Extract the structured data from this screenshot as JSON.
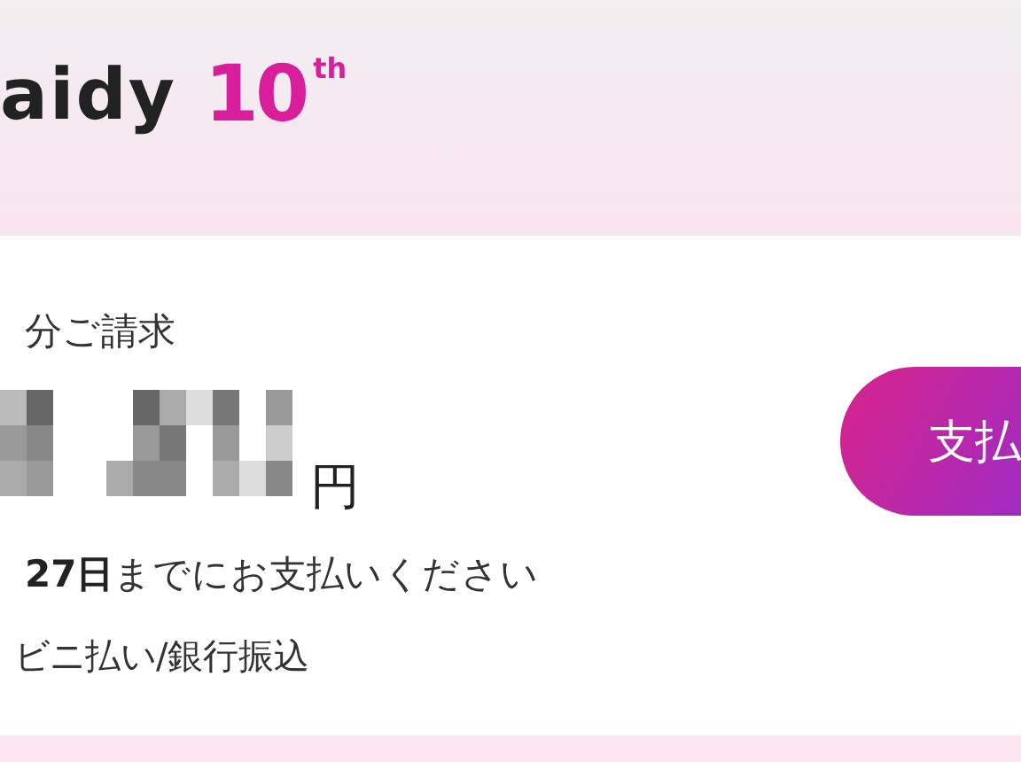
{
  "header": {
    "logo_text": "aidy",
    "logo_number": "10",
    "logo_suffix": "th"
  },
  "bill": {
    "title": "分ご請求",
    "currency": "円",
    "due": "**27日**までにお支払いください",
    "methods": "ビニ払い/銀行振込"
  },
  "pay_button": {
    "label": "支払"
  }
}
